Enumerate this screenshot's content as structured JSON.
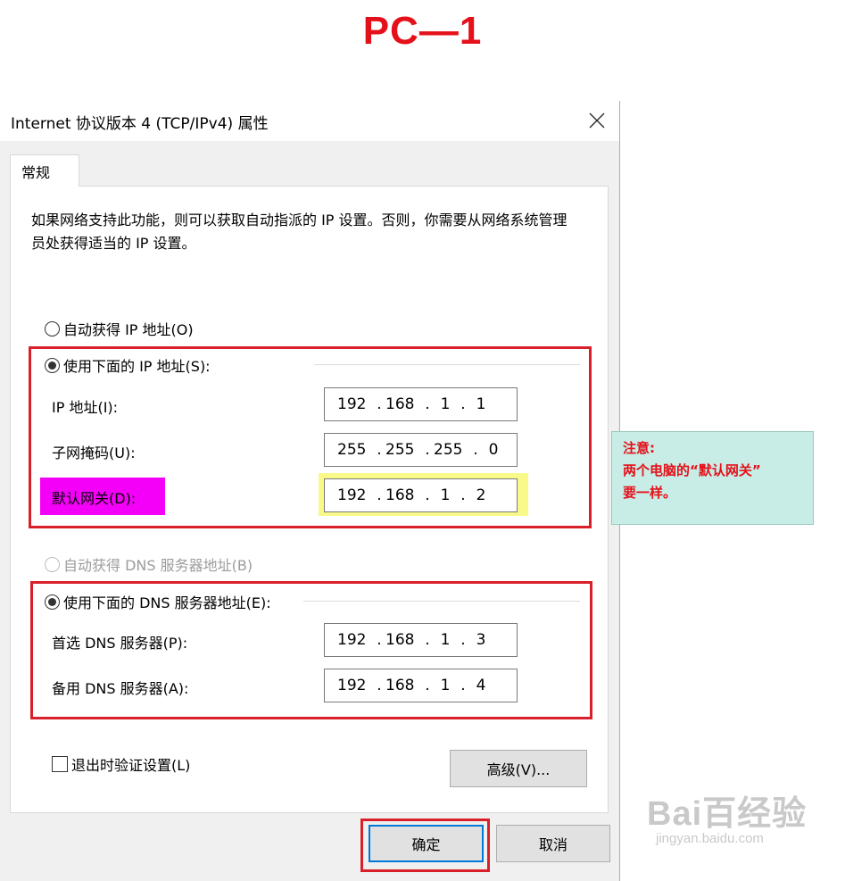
{
  "heading": "PC—1",
  "window": {
    "title": "Internet 协议版本 4 (TCP/IPv4) 属性"
  },
  "tab": "常规",
  "description": "如果网络支持此功能，则可以获取自动指派的 IP 设置。否则，你需要从网络系统管理员处获得适当的 IP 设置。",
  "ip": {
    "auto_label": "自动获得 IP 地址(O)",
    "manual_label": "使用下面的 IP 地址(S):",
    "fields": [
      {
        "label": "IP 地址(I):",
        "octets": [
          "192",
          "168",
          "1",
          "1"
        ]
      },
      {
        "label": "子网掩码(U):",
        "octets": [
          "255",
          "255",
          "255",
          "0"
        ]
      },
      {
        "label": "默认网关(D):",
        "octets": [
          "192",
          "168",
          "1",
          "2"
        ]
      }
    ]
  },
  "dns": {
    "auto_label": "自动获得 DNS 服务器地址(B)",
    "manual_label": "使用下面的 DNS 服务器地址(E):",
    "fields": [
      {
        "label": "首选 DNS 服务器(P):",
        "octets": [
          "192",
          "168",
          "1",
          "3"
        ]
      },
      {
        "label": "备用 DNS 服务器(A):",
        "octets": [
          "192",
          "168",
          "1",
          "4"
        ]
      }
    ]
  },
  "validate_label": "退出时验证设置(L)",
  "buttons": {
    "advanced": "高级(V)...",
    "ok": "确定",
    "cancel": "取消"
  },
  "note": {
    "line1": "注意:",
    "line2": "两个电脑的“默认网关”",
    "line3": "要一样。"
  },
  "watermark": {
    "main": "Bai百经验",
    "sub": "jingyan.baidu.com"
  },
  "colors": {
    "annotation_red": "#d9202a",
    "heading_red": "#e4101a",
    "note_bg": "#c8ede6",
    "highlight_magenta": "#f400f8",
    "highlight_yellow": "#f9f98a",
    "focus_blue": "#0078d7"
  },
  "icons": {
    "close": "close-icon"
  }
}
